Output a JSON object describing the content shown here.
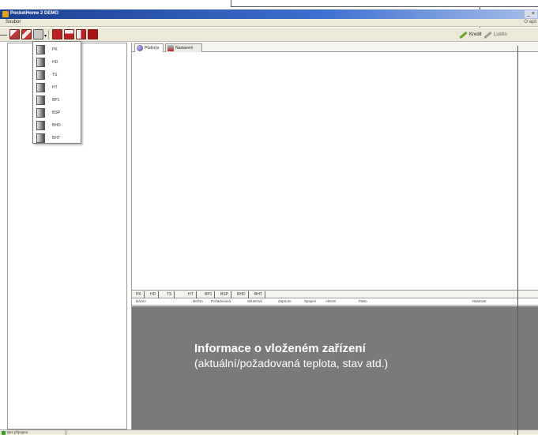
{
  "window": {
    "title": "PocketHome 2 DEMO",
    "controls": "_|&#"
  },
  "menu": {
    "file": "Soubor",
    "right_text": "O apli"
  },
  "toolbar": {
    "kredit_label": "Kredit",
    "lustro_label": "Lustro"
  },
  "dropdown": {
    "items": [
      {
        "label": "PK"
      },
      {
        "label": "HD"
      },
      {
        "label": "TS"
      },
      {
        "label": "HT"
      },
      {
        "label": "BP1"
      },
      {
        "label": "BSP"
      },
      {
        "label": "BHD"
      },
      {
        "label": "BHT"
      }
    ]
  },
  "tabs": {
    "podorys": "Půdorys",
    "nastaveni": "Nastavení"
  },
  "device_tabs": [
    "PK",
    "HD",
    "TS",
    "HT",
    "BP1",
    "BSP",
    "BHD",
    "BHT"
  ],
  "table_headers": [
    "Název",
    "Režim",
    "Požadovaná",
    "Skutečná",
    "Zapnuto",
    "Spojení",
    "Aktivní",
    "Patro",
    "Vlastnost"
  ],
  "info": {
    "title": "Informace o vloženém zařízení",
    "subtitle": "(aktuální/požadovaná teplota, stav atd.)"
  },
  "status": {
    "text": "Bez připojení"
  }
}
